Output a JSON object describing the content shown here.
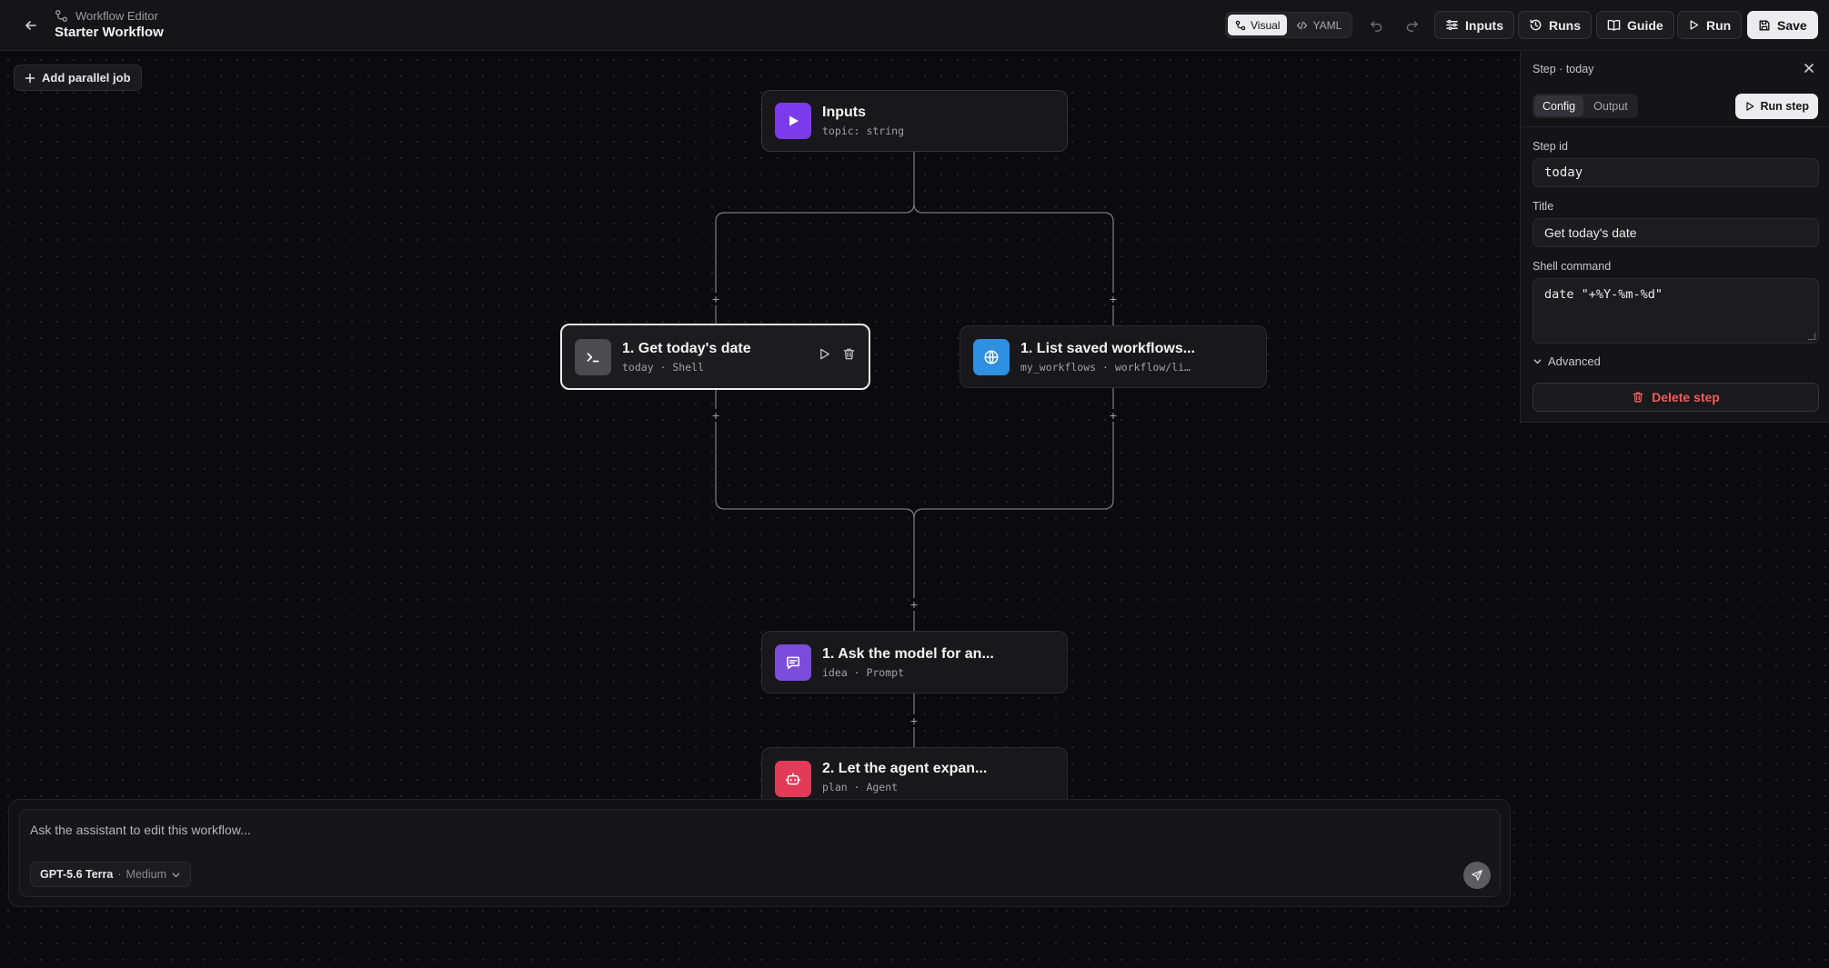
{
  "header": {
    "breadcrumb": "Workflow Editor",
    "title": "Starter Workflow",
    "view_modes": [
      {
        "label": "Visual",
        "active": true
      },
      {
        "label": "YAML",
        "active": false
      }
    ],
    "buttons": {
      "inputs": "Inputs",
      "runs": "Runs",
      "guide": "Guide",
      "run": "Run",
      "save": "Save"
    }
  },
  "canvas": {
    "add_parallel_job": "Add parallel job",
    "nodes": {
      "inputs": {
        "title": "Inputs",
        "subtitle": "topic: string",
        "icon": "play-icon",
        "color": "#7c3aed"
      },
      "today": {
        "title": "1. Get today's date",
        "subtitle": "today · Shell",
        "icon": "terminal-icon",
        "color": "#4b4b50",
        "selected": true
      },
      "list": {
        "title": "1. List saved workflows...",
        "subtitle": "my_workflows · workflow/li…",
        "icon": "globe-icon",
        "color": "#2f8fe0"
      },
      "idea": {
        "title": "1. Ask the model for an...",
        "subtitle": "idea · Prompt",
        "icon": "chat-icon",
        "color": "#7c4ddb"
      },
      "plan": {
        "title": "2. Let the agent expan...",
        "subtitle": "plan · Agent",
        "icon": "robot-icon",
        "color": "#e23b58"
      }
    }
  },
  "panel": {
    "title": "Step · today",
    "tabs": [
      {
        "label": "Config",
        "active": true
      },
      {
        "label": "Output",
        "active": false
      }
    ],
    "run_step": "Run step",
    "fields": {
      "step_id": {
        "label": "Step id",
        "value": "today"
      },
      "title": {
        "label": "Title",
        "value": "Get today's date"
      },
      "shell_command": {
        "label": "Shell command",
        "value": "date \"+%Y-%m-%d\""
      }
    },
    "advanced": "Advanced",
    "delete_step": "Delete step"
  },
  "composer": {
    "placeholder": "Ask the assistant to edit this workflow...",
    "model": "GPT-5.6 Terra",
    "separator": "·",
    "level": "Medium"
  }
}
